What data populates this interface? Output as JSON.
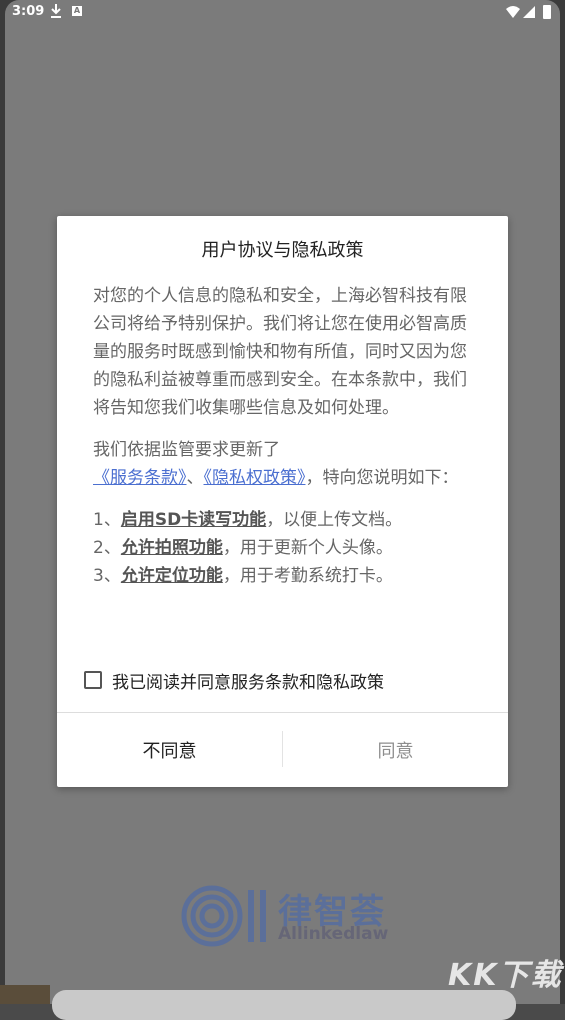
{
  "status_bar": {
    "time": "3:09",
    "icons": [
      "download-icon",
      "a-notification-icon",
      "wifi-icon",
      "signal-icon",
      "battery-icon"
    ],
    "a_label": "A"
  },
  "dialog": {
    "title": "用户协议与隐私政策",
    "paragraph1": "对您的个人信息的隐私和安全，上海必智科技有限公司将给予特别保护。我们将让您在使用必智高质量的服务时既感到愉快和物有所值，同时又因为您的隐私利益被尊重而感到安全。在本条款中，我们将告知您我们收集哪些信息及如何处理。",
    "paragraph2_intro": "我们依据监管要求更新了",
    "service_terms_link": "《服务条款》",
    "separator": "、",
    "privacy_policy_link": "《隐私权政策》",
    "paragraph2_tail": "，特向您说明如下：",
    "items": [
      {
        "num": "1、",
        "bold": "启用SD卡读写功能",
        "rest": "，以便上传文档。"
      },
      {
        "num": "2、",
        "bold": "允许拍照功能",
        "rest": "，用于更新个人头像。"
      },
      {
        "num": "3、",
        "bold": "允许定位功能",
        "rest": "，用于考勤系统打卡。"
      }
    ],
    "agree_checkbox_label": "我已阅读并同意服务条款和隐私政策",
    "disagree_button": "不同意",
    "agree_button": "同意"
  },
  "background": {
    "logo_cn": "律智荟",
    "logo_en": "Allinkedlaw",
    "watermark": "KK下载"
  },
  "colors": {
    "link": "#4b6fd0",
    "agree_disabled": "#8e8e8e",
    "overlay": "#7b7b7b"
  }
}
